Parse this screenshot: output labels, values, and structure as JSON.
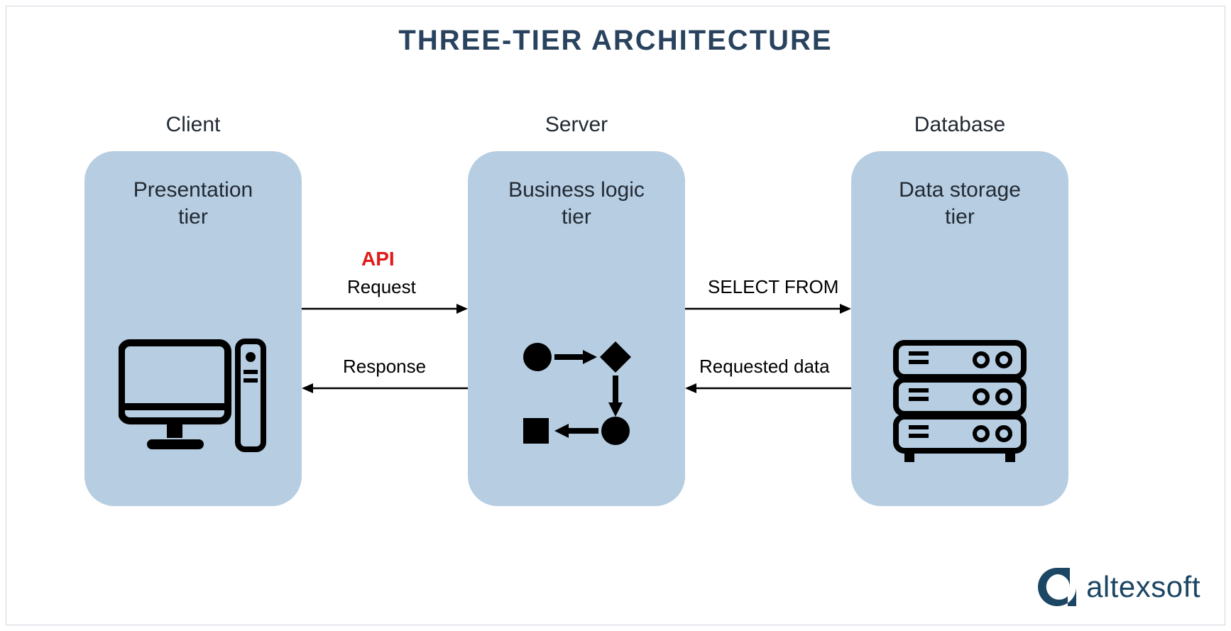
{
  "title": "THREE-TIER ARCHITECTURE",
  "tiers": {
    "client": {
      "label": "Client",
      "box_title_line1": "Presentation",
      "box_title_line2": "tier"
    },
    "server": {
      "label": "Server",
      "box_title_line1": "Business logic",
      "box_title_line2": "tier"
    },
    "database": {
      "label": "Database",
      "box_title_line1": "Data storage",
      "box_title_line2": "tier"
    }
  },
  "connections": {
    "api_tag": "API",
    "client_to_server": "Request",
    "server_to_client": "Response",
    "server_to_database": "SELECT FROM",
    "database_to_server": "Requested data"
  },
  "branding": {
    "name": "altexsoft"
  },
  "colors": {
    "title": "#29435f",
    "box_bg": "#b6cde2",
    "api": "#e11919",
    "logo": "#1b4664"
  }
}
